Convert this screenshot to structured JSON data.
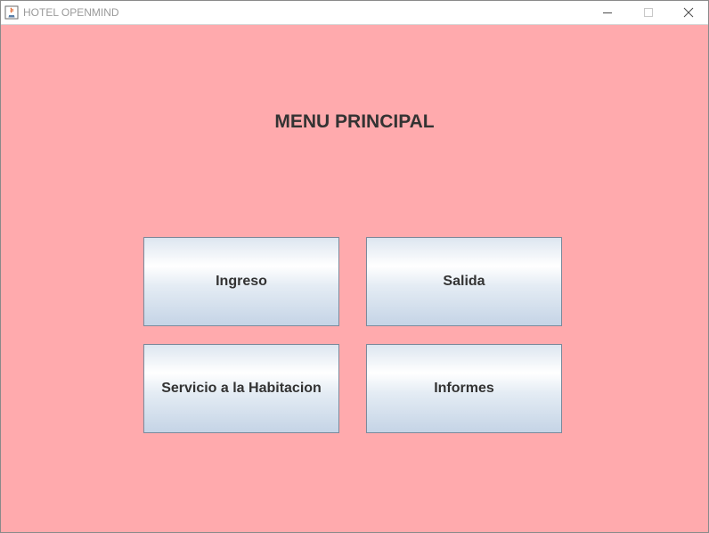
{
  "window": {
    "title": "HOTEL OPENMIND",
    "background_color": "#ffaaad"
  },
  "main": {
    "heading": "MENU PRINCIPAL",
    "buttons": [
      {
        "label": "Ingreso"
      },
      {
        "label": "Salida"
      },
      {
        "label": "Servicio a la Habitacion"
      },
      {
        "label": "Informes"
      }
    ]
  }
}
